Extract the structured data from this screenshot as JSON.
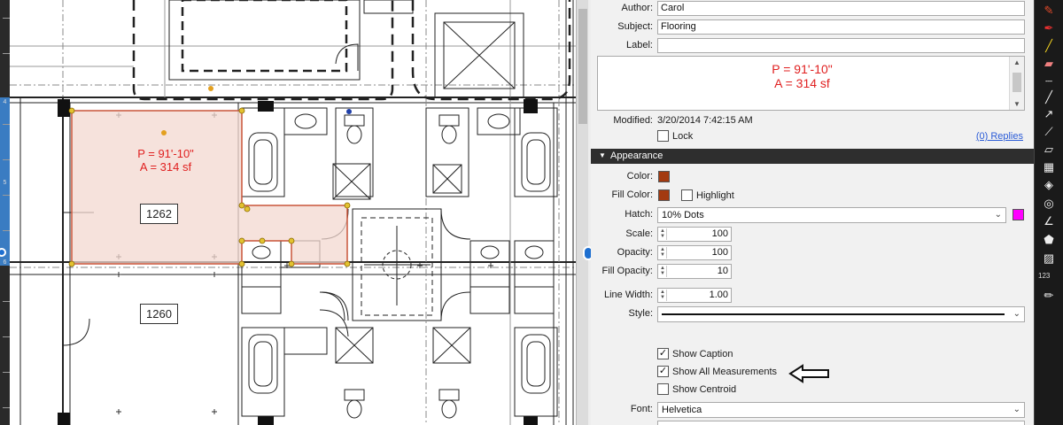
{
  "ruler": {
    "numbers": [
      "4",
      "5",
      "6"
    ]
  },
  "drawing": {
    "room_labels": [
      "1262",
      "1260"
    ],
    "measurement": {
      "perimeter": "P = 91'-10\"",
      "area": "A = 314 sf"
    }
  },
  "panel": {
    "author": {
      "label": "Author:",
      "value": "Carol"
    },
    "subject": {
      "label": "Subject:",
      "value": "Flooring"
    },
    "label_field": {
      "label": "Label:",
      "value": ""
    },
    "caption": {
      "line1": "P = 91'-10\"",
      "line2": "A = 314 sf"
    },
    "modified": {
      "label": "Modified:",
      "value": "3/20/2014 7:42:15 AM"
    },
    "lock": {
      "label": "Lock",
      "checked": false
    },
    "replies": "(0) Replies",
    "appearance": {
      "title": "Appearance",
      "color": {
        "label": "Color:",
        "value": "#a33a10"
      },
      "fill_color": {
        "label": "Fill Color:",
        "value": "#a33a10"
      },
      "highlight": {
        "label": "Highlight",
        "checked": false
      },
      "hatch": {
        "label": "Hatch:",
        "value": "10% Dots",
        "color": "#ff00ff"
      },
      "scale": {
        "label": "Scale:",
        "value": "100"
      },
      "opacity": {
        "label": "Opacity:",
        "value": "100"
      },
      "fill_opacity": {
        "label": "Fill Opacity:",
        "value": "10"
      },
      "line_width": {
        "label": "Line Width:",
        "value": "1.00"
      },
      "style": {
        "label": "Style:"
      },
      "show_caption": {
        "label": "Show Caption",
        "checked": true
      },
      "show_all_measurements": {
        "label": "Show All Measurements",
        "checked": true
      },
      "show_centroid": {
        "label": "Show Centroid",
        "checked": false
      },
      "font": {
        "label": "Font:",
        "value": "Helvetica"
      }
    }
  },
  "toolbar": {
    "icons": [
      "highlighter-icon",
      "pen-icon",
      "marker-icon",
      "eraser-icon",
      "dotted-line-icon",
      "line-icon",
      "arrow-icon",
      "measure-icon",
      "ruler-icon",
      "note-icon",
      "cube-icon",
      "circle-icon",
      "angle-icon",
      "polygon-icon",
      "area-icon",
      "count-icon"
    ],
    "count_label": "123"
  }
}
